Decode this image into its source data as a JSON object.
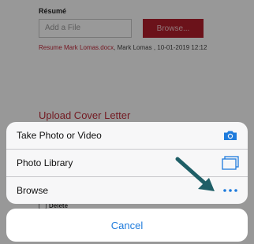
{
  "form": {
    "resume_label": "Résumé",
    "file_placeholder": "Add a File",
    "browse_label": "Browse...",
    "file_name": "Resume Mark Lomas.docx",
    "file_meta": ", Mark Lomas , 10-01-2019 12:12",
    "cover_letter_heading": "Upload Cover Letter",
    "delete_label": "Delete"
  },
  "action_sheet": {
    "items": [
      {
        "label": "Take Photo or Video",
        "icon": "camera-icon"
      },
      {
        "label": "Photo Library",
        "icon": "photo-library-icon"
      },
      {
        "label": "Browse",
        "icon": "more-dots-icon"
      }
    ],
    "cancel_label": "Cancel"
  },
  "colors": {
    "accent_blue": "#1e7bdc",
    "brand_red": "#b21e2c",
    "arrow_teal": "#1f5f67"
  }
}
